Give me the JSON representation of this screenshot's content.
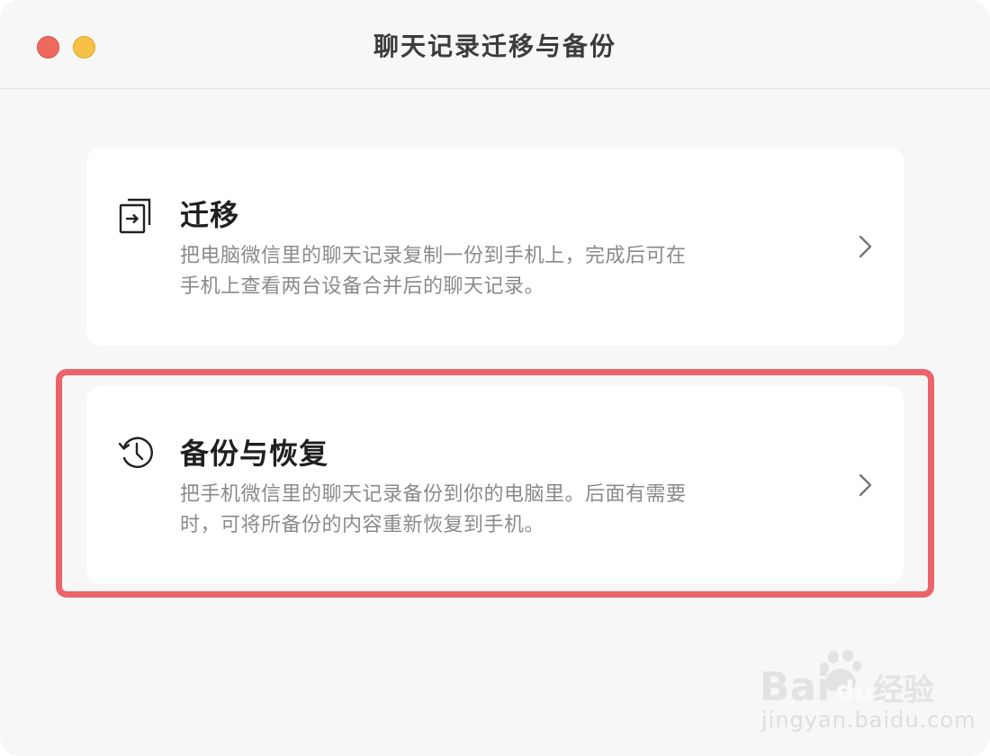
{
  "window": {
    "title": "聊天记录迁移与备份"
  },
  "cards": [
    {
      "icon": "import-arrow-icon",
      "title": "迁移",
      "desc_line1": "把电脑微信里的聊天记录复制一份到手机上，完成后可在",
      "desc_line2": "手机上查看两台设备合并后的聊天记录。"
    },
    {
      "icon": "history-clock-icon",
      "title": "备份与恢复",
      "desc_line1": "把手机微信里的聊天记录备份到你的电脑里。后面有需要",
      "desc_line2": "时，可将所备份的内容重新恢复到手机。"
    }
  ],
  "watermark": {
    "logo_text": "Baidu经验",
    "url": "jingyan.baidu.com"
  },
  "colors": {
    "highlight": "#ec636b",
    "close": "#ee6a5e",
    "minimize": "#f6c046"
  }
}
